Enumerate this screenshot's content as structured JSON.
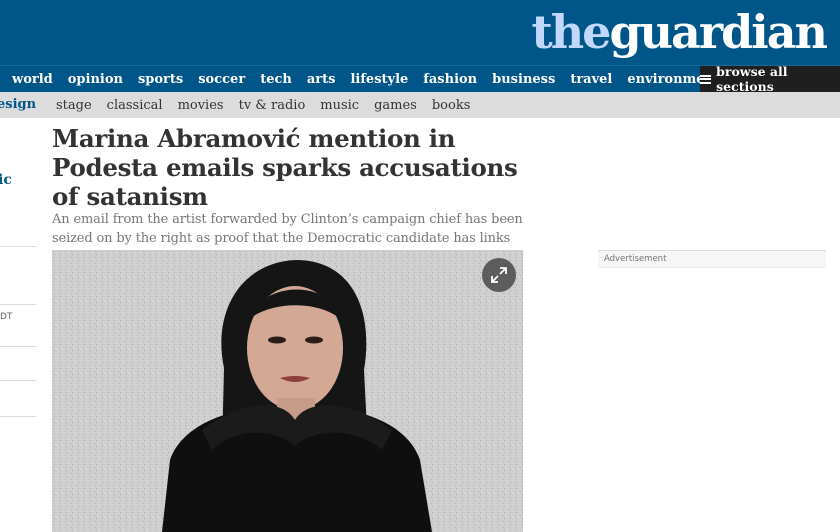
{
  "logo": {
    "the": "the",
    "guardian": "guardian"
  },
  "nav_primary": [
    "world",
    "opinion",
    "sports",
    "soccer",
    "tech",
    "arts",
    "lifestyle",
    "fashion",
    "business",
    "travel",
    "environment"
  ],
  "browse_label": "browse all sections",
  "nav_secondary": {
    "cut_label": "esign",
    "items": [
      "stage",
      "classical",
      "movies",
      "tv & radio",
      "music",
      "games",
      "books"
    ]
  },
  "left_rail": {
    "fragment_1": "ic",
    "fragment_2": "DT"
  },
  "article": {
    "headline": "Marina Abramović mention in Podesta emails sparks accusations of satanism",
    "standfirst": "An email from the artist forwarded by Clinton’s campaign chief has been seized on by the right as proof that the Democratic candidate has links with the occult"
  },
  "advertisement_label": "Advertisement",
  "colors": {
    "brand_blue": "#005689",
    "logo_tint": "#c1d8fc",
    "browse_bg": "#1f1f1f",
    "subnav_bg": "#dcdcdc"
  },
  "icons": {
    "menu": "hamburger-icon",
    "expand": "expand-icon"
  }
}
